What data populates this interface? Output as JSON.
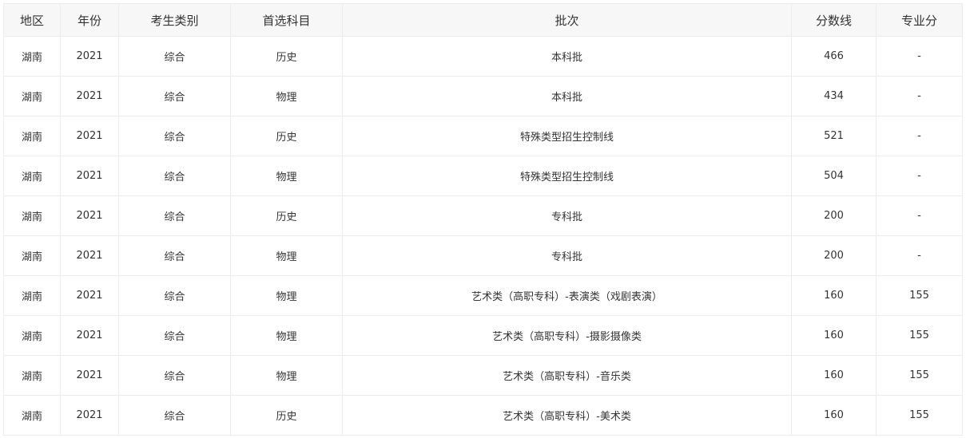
{
  "table": {
    "headers": [
      "地区",
      "年份",
      "考生类别",
      "首选科目",
      "批次",
      "分数线",
      "专业分"
    ],
    "rows": [
      [
        "湖南",
        "2021",
        "综合",
        "历史",
        "本科批",
        "466",
        "-"
      ],
      [
        "湖南",
        "2021",
        "综合",
        "物理",
        "本科批",
        "434",
        "-"
      ],
      [
        "湖南",
        "2021",
        "综合",
        "历史",
        "特殊类型招生控制线",
        "521",
        "-"
      ],
      [
        "湖南",
        "2021",
        "综合",
        "物理",
        "特殊类型招生控制线",
        "504",
        "-"
      ],
      [
        "湖南",
        "2021",
        "综合",
        "历史",
        "专科批",
        "200",
        "-"
      ],
      [
        "湖南",
        "2021",
        "综合",
        "物理",
        "专科批",
        "200",
        "-"
      ],
      [
        "湖南",
        "2021",
        "综合",
        "物理",
        "艺术类（高职专科）-表演类（戏剧表演）",
        "160",
        "155"
      ],
      [
        "湖南",
        "2021",
        "综合",
        "物理",
        "艺术类（高职专科）-摄影摄像类",
        "160",
        "155"
      ],
      [
        "湖南",
        "2021",
        "综合",
        "物理",
        "艺术类（高职专科）-音乐类",
        "160",
        "155"
      ],
      [
        "湖南",
        "2021",
        "综合",
        "历史",
        "艺术类（高职专科）-美术类",
        "160",
        "155"
      ]
    ]
  }
}
